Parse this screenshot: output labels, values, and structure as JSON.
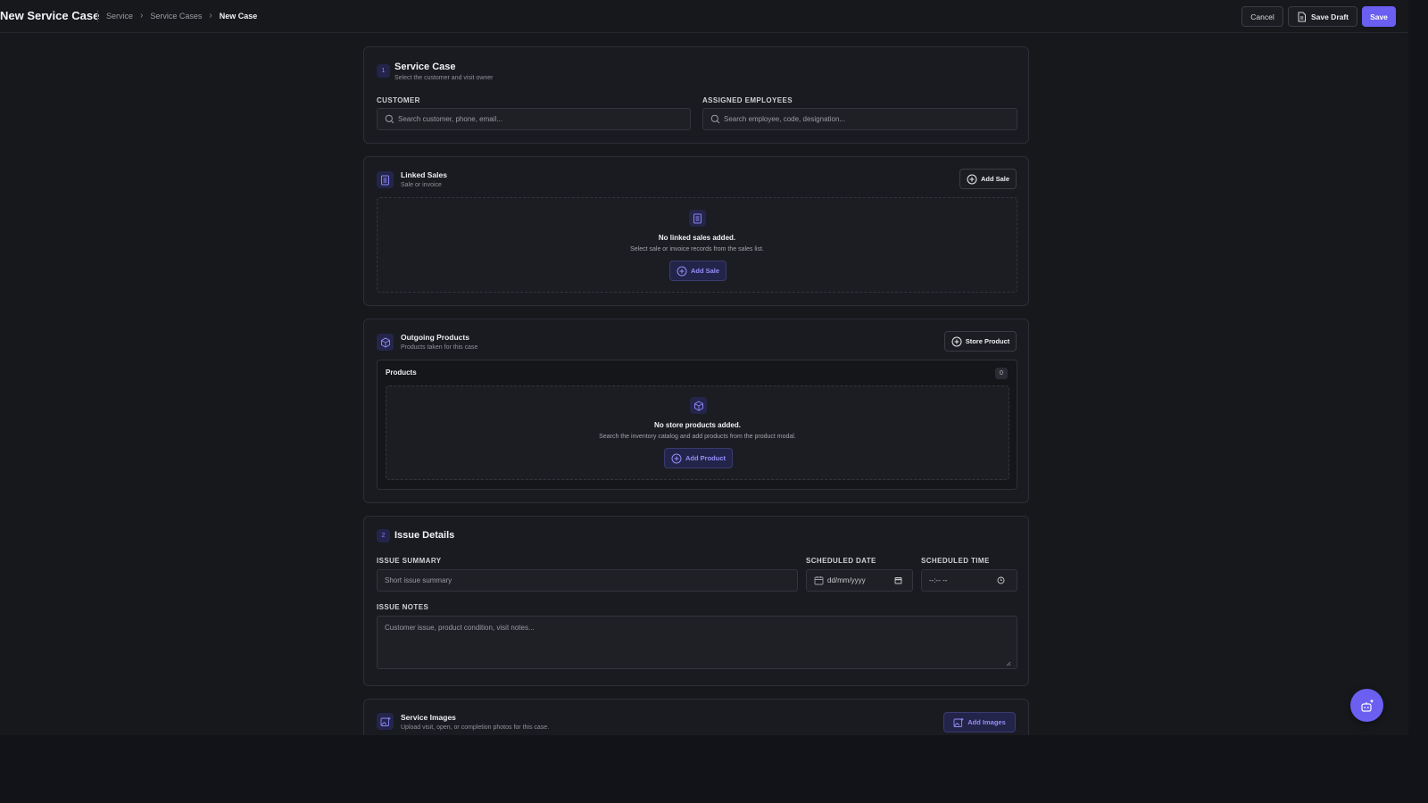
{
  "header": {
    "title": "New Service Case",
    "breadcrumb": [
      "Service",
      "Service Cases",
      "New Case"
    ],
    "cancel_label": "Cancel",
    "save_draft_label": "Save Draft",
    "save_label": "Save"
  },
  "service_case": {
    "step": "1",
    "title": "Service Case",
    "subtitle": "Select the customer and visit owner",
    "customer_label": "CUSTOMER",
    "customer_placeholder": "Search customer, phone, email...",
    "employees_label": "ASSIGNED EMPLOYEES",
    "employees_placeholder": "Search employee, code, designation..."
  },
  "linked_sales": {
    "title": "Linked Sales",
    "subtitle": "Sale or invoice",
    "add_label": "Add Sale",
    "empty_title": "No linked sales added.",
    "empty_subtitle": "Select sale or invoice records from the sales list.",
    "empty_button": "Add Sale"
  },
  "outgoing_products": {
    "title": "Outgoing Products",
    "subtitle": "Products taken for this case",
    "store_label": "Store Product",
    "products_title": "Products",
    "products_count": "0",
    "empty_title": "No store products added.",
    "empty_subtitle": "Search the inventory catalog and add products from the product modal.",
    "empty_button": "Add Product"
  },
  "issue_details": {
    "step": "2",
    "title": "Issue Details",
    "summary_label": "ISSUE SUMMARY",
    "summary_placeholder": "Short issue summary",
    "date_label": "SCHEDULED DATE",
    "date_placeholder": "dd/mm/yyyy",
    "time_label": "SCHEDULED TIME",
    "time_placeholder": "--:-- --",
    "notes_label": "ISSUE NOTES",
    "notes_placeholder": "Customer issue, product condition, visit notes..."
  },
  "service_images": {
    "title": "Service Images",
    "subtitle": "Upload visit, open, or completion photos for this case.",
    "add_label": "Add Images"
  },
  "colors": {
    "accent": "#6a5ff0",
    "background": "#17181c",
    "card": "#1a1b20"
  }
}
